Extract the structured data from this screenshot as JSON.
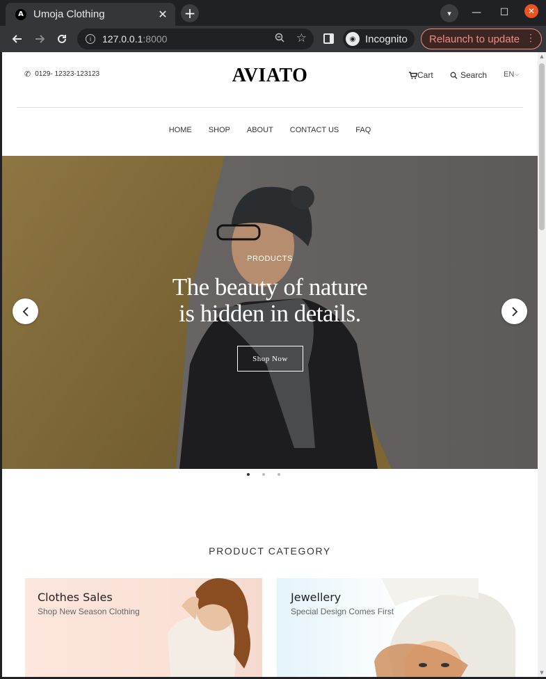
{
  "browser": {
    "tab_title": "Umoja Clothing",
    "tab_favicon_letter": "A",
    "url_host": "127.0.0.1",
    "url_port": ":8000",
    "incognito_label": "Incognito",
    "relaunch_label": "Relaunch to update"
  },
  "header": {
    "phone": "0129- 12323-123123",
    "logo": "AVIATO",
    "cart_label": "Cart",
    "search_label": "Search",
    "language": "EN"
  },
  "menu": {
    "items": [
      "HOME",
      "SHOP",
      "ABOUT",
      "CONTACT US",
      "FAQ"
    ]
  },
  "hero": {
    "eyebrow": "PRODUCTS",
    "title_line1": "The beauty of nature",
    "title_line2": "is hidden in details.",
    "button_label": "Shop Now",
    "slide_count": 3,
    "active_slide": 1
  },
  "categories": {
    "section_title": "PRODUCT CATEGORY",
    "items": [
      {
        "title": "Clothes Sales",
        "subtitle": "Shop New Season Clothing"
      },
      {
        "title": "Jewellery",
        "subtitle": "Special Design Comes First"
      }
    ]
  },
  "colors": {
    "chrome_dark": "#202124",
    "chrome_toolbar": "#35363a",
    "relaunch_accent": "#f28b82",
    "close_button": "#e95420"
  },
  "icons": [
    "back-arrow-icon",
    "forward-arrow-icon",
    "reload-icon",
    "info-icon",
    "zoom-out-icon",
    "star-icon",
    "side-panel-icon",
    "incognito-icon",
    "kebab-menu-icon",
    "phone-icon",
    "cart-icon",
    "search-icon",
    "chevron-down-icon",
    "chevron-left-icon",
    "chevron-right-icon"
  ]
}
